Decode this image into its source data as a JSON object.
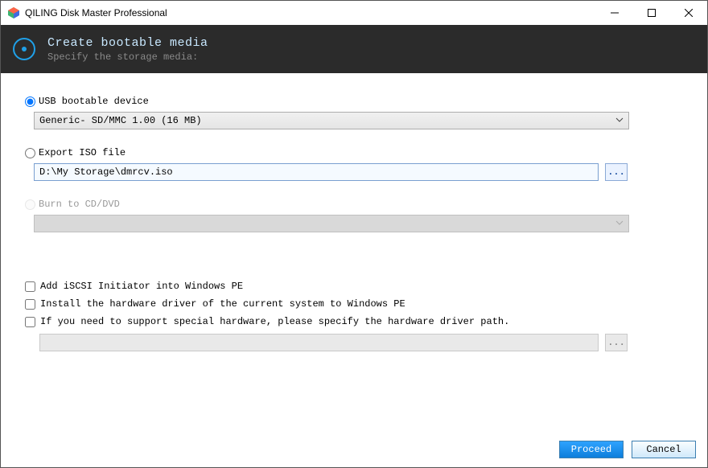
{
  "window": {
    "title": "QILING Disk Master Professional"
  },
  "banner": {
    "heading": "Create bootable media",
    "subheading": "Specify the storage media:"
  },
  "options": {
    "usb": {
      "label": "USB bootable device",
      "selected": true,
      "device": "Generic- SD/MMC 1.00 (16 MB)"
    },
    "iso": {
      "label": "Export ISO file",
      "selected": false,
      "path": "D:\\My Storage\\dmrcv.iso"
    },
    "cd": {
      "label": "Burn to CD/DVD",
      "selected": false,
      "disabled": true,
      "device": ""
    }
  },
  "checkboxes": {
    "iscsi": {
      "label": "Add iSCSI Initiator into Windows PE",
      "checked": false
    },
    "driver": {
      "label": "Install the hardware driver of the current system to Windows PE",
      "checked": false
    },
    "path": {
      "label": "If you need to support special hardware, please specify the hardware driver path.",
      "checked": false,
      "value": ""
    }
  },
  "buttons": {
    "browse": "...",
    "proceed": "Proceed",
    "cancel": "Cancel"
  }
}
